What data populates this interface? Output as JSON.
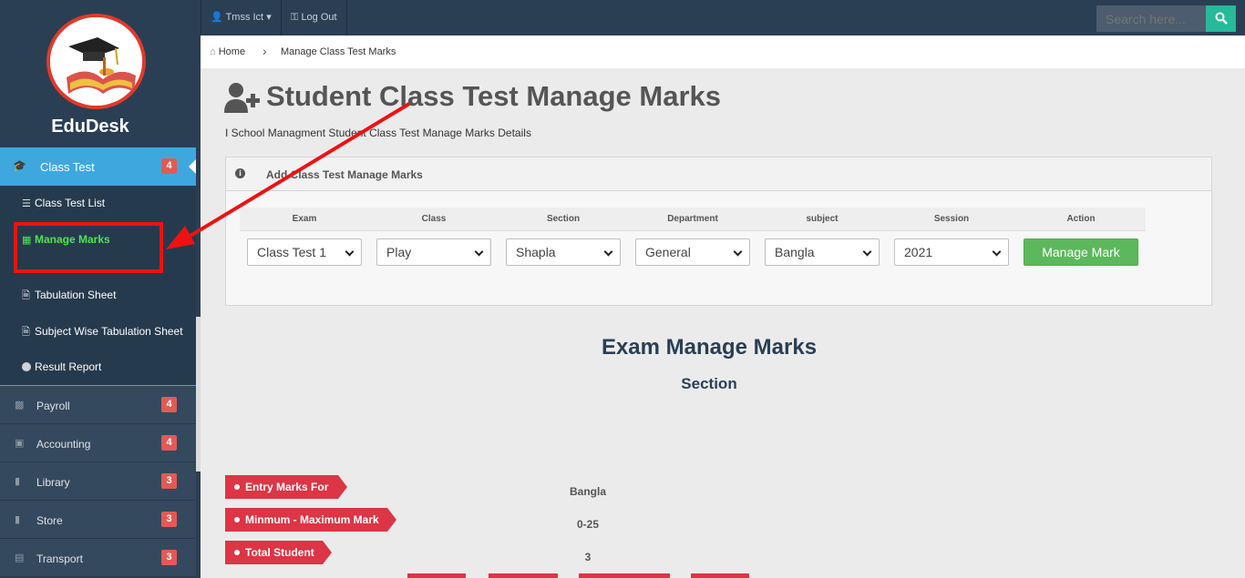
{
  "brand": "EduDesk",
  "sidebar": {
    "active": {
      "label": "Class Test",
      "badge": "4",
      "icon": "graduation-cap-icon"
    },
    "sub": [
      {
        "label": "Class Test List",
        "icon": "list-icon"
      },
      {
        "label": "Manage Marks",
        "icon": "calculator-icon"
      },
      {
        "label": "Tabulation Sheet",
        "icon": "file-icon"
      },
      {
        "label": "Subject Wise Tabulation Sheet",
        "icon": "file-icon"
      },
      {
        "label": "Result Report",
        "icon": "circle-icon"
      }
    ],
    "items": [
      {
        "label": "Payroll",
        "badge": "4",
        "icon": "money-icon"
      },
      {
        "label": "Accounting",
        "badge": "4",
        "icon": "briefcase-icon"
      },
      {
        "label": "Library",
        "badge": "3",
        "icon": "book-icon"
      },
      {
        "label": "Store",
        "badge": "3",
        "icon": "book-icon"
      },
      {
        "label": "Transport",
        "badge": "3",
        "icon": "id-card-icon"
      }
    ]
  },
  "topbar": {
    "user": "Tmss Ict",
    "logout": "Log Out",
    "search_placeholder": "Search here..."
  },
  "breadcrumb": {
    "home": "Home",
    "current": "Manage Class Test Marks"
  },
  "page": {
    "title": "Student Class Test Manage Marks",
    "subtitle": "I School Managment Student Class Test Manage Marks Details"
  },
  "panel": {
    "title": "Add Class Test Manage Marks",
    "headers": [
      "Exam",
      "Class",
      "Section",
      "Department",
      "subject",
      "Session",
      "Action"
    ],
    "selects": [
      "Class Test 1",
      "Play",
      "Shapla",
      "General",
      "Bangla",
      "2021"
    ],
    "button": "Manage Mark"
  },
  "exam": {
    "heading": "Exam Manage Marks",
    "subheading": "Section"
  },
  "info": [
    {
      "label": "Entry Marks For",
      "value": "Bangla"
    },
    {
      "label": "Minmum - Maximum Mark",
      "value": "0-25"
    },
    {
      "label": "Total Student",
      "value": "3"
    }
  ],
  "colors": {
    "sidebar": "#2a3f54",
    "active": "#3ea8de",
    "success": "#5cb85c",
    "danger": "#dc3545",
    "search": "#26b99a"
  }
}
